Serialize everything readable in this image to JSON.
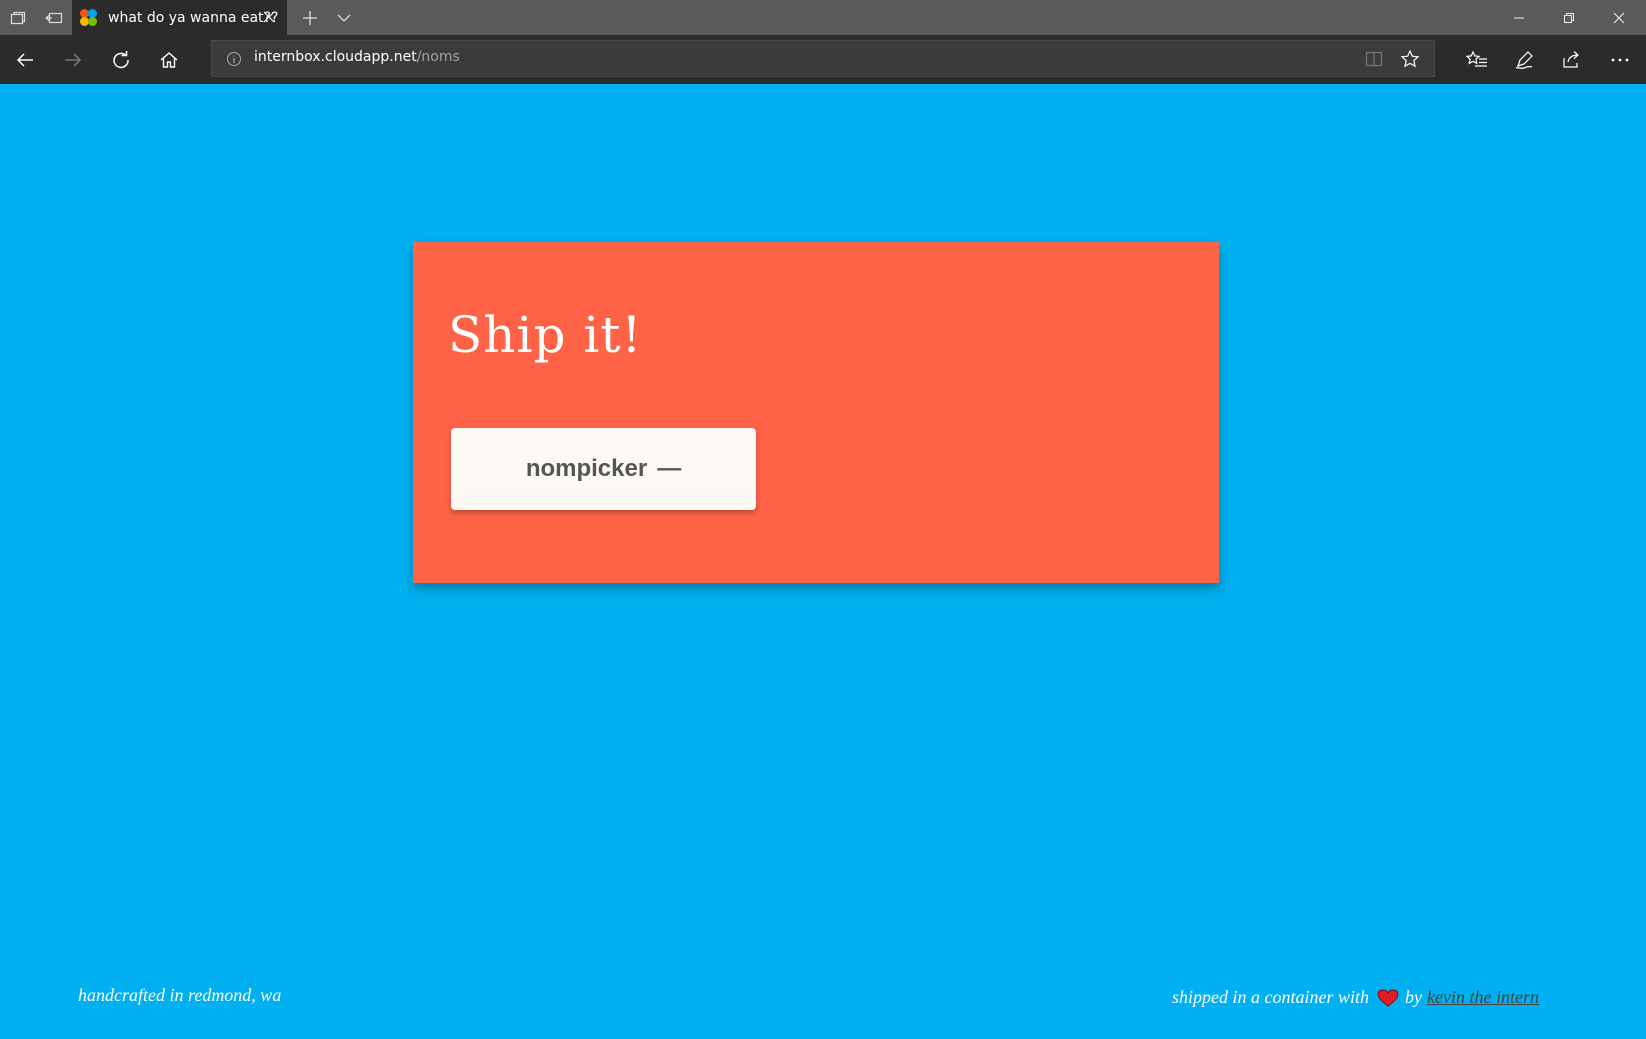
{
  "browser": {
    "tab": {
      "title": "what do ya wanna eat??"
    },
    "address": {
      "domain": "internbox.cloudapp.net",
      "path": "/noms"
    },
    "accent_colors": {
      "favicon": [
        "#00a1f1",
        "#ffbb00",
        "#f65314",
        "#7cbb00"
      ]
    }
  },
  "page": {
    "background": "#00b0f0",
    "card": {
      "background": "#ff6347",
      "title": "Ship it!",
      "button_label": "nompicker",
      "button_suffix": "—"
    },
    "footer": {
      "left_text": "handcrafted in redmond, wa",
      "right_prefix": "shipped in a container with",
      "right_by": "by",
      "author": "kevin the intern"
    }
  }
}
